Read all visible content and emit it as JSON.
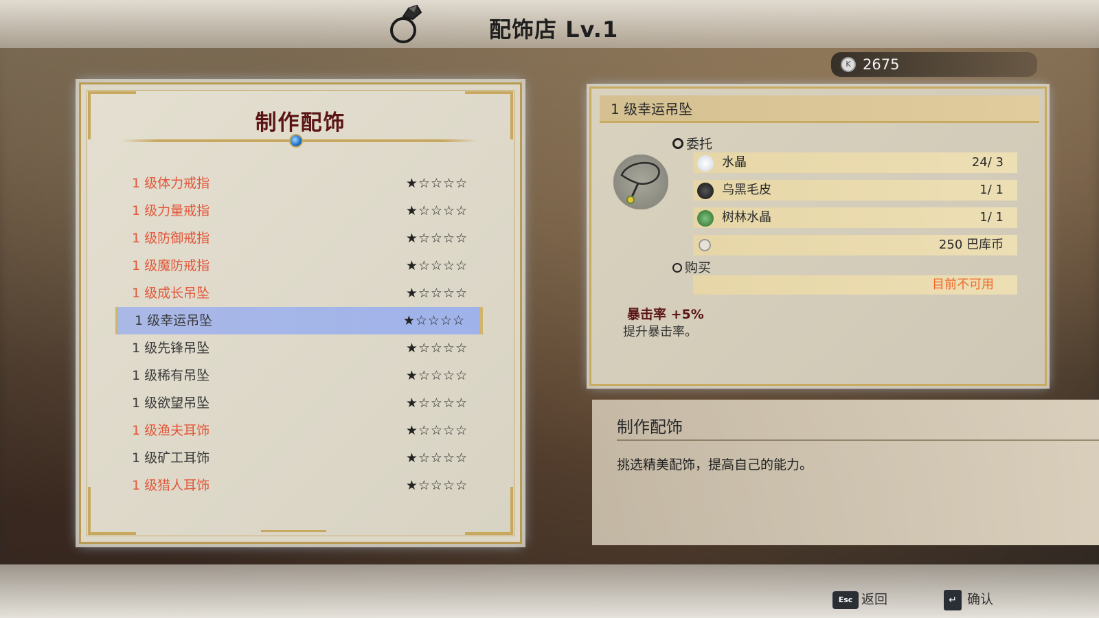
{
  "header": {
    "shop_title": "配饰店 Lv.1",
    "money": "2675",
    "money_icon": "coin-icon"
  },
  "left_panel": {
    "title": "制作配饰",
    "items": [
      {
        "name": "1 级体力戒指",
        "stars": "★☆☆☆☆",
        "highlight": "red"
      },
      {
        "name": "1 级力量戒指",
        "stars": "★☆☆☆☆",
        "highlight": "red"
      },
      {
        "name": "1 级防御戒指",
        "stars": "★☆☆☆☆",
        "highlight": "red"
      },
      {
        "name": "1 级魔防戒指",
        "stars": "★☆☆☆☆",
        "highlight": "red"
      },
      {
        "name": "1 级成长吊坠",
        "stars": "★☆☆☆☆",
        "highlight": "red"
      },
      {
        "name": "1 级幸运吊坠",
        "stars": "★☆☆☆☆",
        "highlight": "selected"
      },
      {
        "name": "1 级先锋吊坠",
        "stars": "★☆☆☆☆",
        "highlight": "normal"
      },
      {
        "name": "1 级稀有吊坠",
        "stars": "★☆☆☆☆",
        "highlight": "normal"
      },
      {
        "name": "1 级欲望吊坠",
        "stars": "★☆☆☆☆",
        "highlight": "normal"
      },
      {
        "name": "1 级渔夫耳饰",
        "stars": "★☆☆☆☆",
        "highlight": "red"
      },
      {
        "name": "1 级矿工耳饰",
        "stars": "★☆☆☆☆",
        "highlight": "normal"
      },
      {
        "name": "1 级猎人耳饰",
        "stars": "★☆☆☆☆",
        "highlight": "red"
      }
    ]
  },
  "detail": {
    "item_name": "1 级幸运吊坠",
    "commission_label": "委托",
    "materials": [
      {
        "name": "水晶",
        "count": "24/ 3",
        "icon": "crystal-icon"
      },
      {
        "name": "乌黑毛皮",
        "count": "1/ 1",
        "icon": "fur-icon"
      },
      {
        "name": "树林水晶",
        "count": "1/ 1",
        "icon": "forest-crystal-icon"
      },
      {
        "name": "",
        "count": "250 巴库币",
        "icon": "coin-icon"
      }
    ],
    "buy_label": "购买",
    "buy_status": "目前不可用",
    "effect_title": "暴击率 +5%",
    "effect_desc": "提升暴击率。"
  },
  "info": {
    "title": "制作配饰",
    "desc": "挑选精美配饰，提高自己的能力。"
  },
  "controls": {
    "back_key": "Esc",
    "back_label": "返回",
    "confirm_label": "确认"
  }
}
